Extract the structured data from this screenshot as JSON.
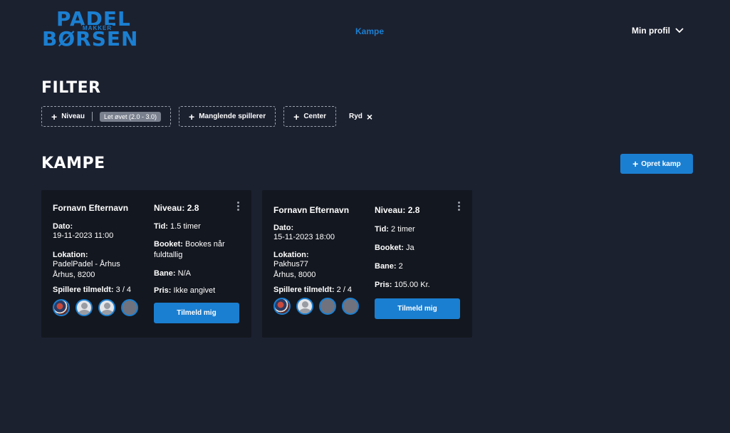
{
  "logo": {
    "line1": "PADEL",
    "line2": "MAKKER",
    "line3": "BØRSEN"
  },
  "nav": {
    "matches_link": "Kampe",
    "profile_label": "Min profil"
  },
  "filter": {
    "title": "FILTER",
    "chips": [
      {
        "label": "Niveau",
        "badge": "Let øvet (2.0 - 3.0)"
      },
      {
        "label": "Manglende spillerer"
      },
      {
        "label": "Center"
      }
    ],
    "reset_label": "Ryd",
    "reset_icon": "×"
  },
  "matches": {
    "title": "KAMPE",
    "create_label": "Opret kamp",
    "labels": {
      "date": "Dato:",
      "location": "Lokation:",
      "players": "Spillere tilmeldt:",
      "level": "Niveau:",
      "time": "Tid:",
      "booked": "Booket:",
      "court": "Bane:",
      "price": "Pris:"
    },
    "join_label": "Tilmeld mig",
    "cards": [
      {
        "name": "Fornavn Efternavn",
        "date": "19-11-2023 11:00",
        "location_line1": "PadelPadel - Århus",
        "location_line2": "Århus,  8200",
        "players": "3 / 4",
        "level": "2.8",
        "time": "1.5 timer",
        "booked": "Bookes når fuldtallig",
        "court": "N/A",
        "price": "Ikke angivet",
        "avatars": [
          "photo",
          "user",
          "user",
          "empty"
        ]
      },
      {
        "name": "Fornavn Efternavn",
        "date": "15-11-2023 18:00",
        "location_line1": "Pakhus77",
        "location_line2": "Århus,  8000",
        "players": "2 / 4",
        "level": "2.8",
        "time": "2 timer",
        "booked": "Ja",
        "court": "2",
        "price": "105.00 Kr.",
        "avatars": [
          "photo",
          "user",
          "empty",
          "empty"
        ]
      }
    ]
  },
  "colors": {
    "background": "#1c2130",
    "card": "#13171f",
    "accent": "#1b7fd1"
  }
}
